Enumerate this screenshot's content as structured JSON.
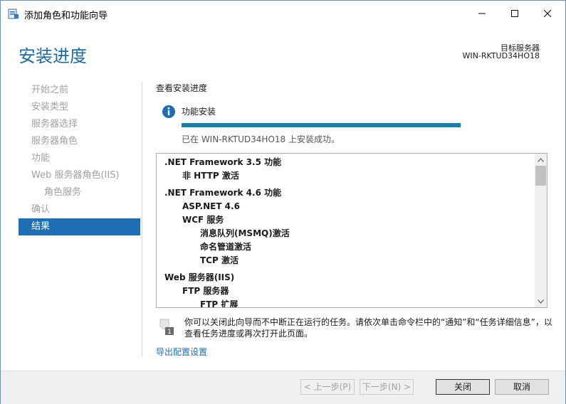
{
  "window": {
    "title": "添加角色和功能向导"
  },
  "header": {
    "page_title": "安装进度",
    "target_label": "目标服务器",
    "target_server": "WIN-RKTUD34HO18"
  },
  "nav": {
    "items": [
      {
        "label": "开始之前"
      },
      {
        "label": "安装类型"
      },
      {
        "label": "服务器选择"
      },
      {
        "label": "服务器角色"
      },
      {
        "label": "功能"
      },
      {
        "label": "Web 服务器角色(IIS)"
      },
      {
        "label": "角色服务"
      },
      {
        "label": "确认"
      },
      {
        "label": "结果"
      }
    ],
    "active_index": 8
  },
  "main": {
    "section_heading": "查看安装进度",
    "feature_label": "功能安装",
    "progress_fraction": 1.0,
    "success_message": "已在 WIN-RKTUD34HO18 上安装成功。",
    "results": [
      {
        "label": ".NET Framework 3.5 功能",
        "level": 0
      },
      {
        "label": "非 HTTP 激活",
        "level": 1
      },
      {
        "label": ".NET Framework 4.6 功能",
        "level": 0
      },
      {
        "label": "ASP.NET 4.6",
        "level": 1
      },
      {
        "label": "WCF 服务",
        "level": 1
      },
      {
        "label": "消息队列(MSMQ)激活",
        "level": 2
      },
      {
        "label": "命名管道激活",
        "level": 2
      },
      {
        "label": "TCP 激活",
        "level": 2
      },
      {
        "label": "Web 服务器(IIS)",
        "level": 0
      },
      {
        "label": "FTP 服务器",
        "level": 1
      },
      {
        "label": "FTP 扩展",
        "level": 2
      }
    ],
    "note": "你可以关闭此向导而不中断正在运行的任务。请依次单击命令栏中的“通知”和“任务详细信息”，以查看任务进度或再次打开此页面。",
    "export_link": "导出配置设置"
  },
  "footer": {
    "prev_label": "< 上一步(P)",
    "next_label": "下一步(N) >",
    "close_label": "关闭",
    "cancel_label": "取消"
  },
  "colors": {
    "accent": "#1f6db3",
    "progress": "#1b7ea6",
    "title_text": "#1e6aa8"
  },
  "icons": [
    "wizard-app-icon",
    "minimize-icon",
    "maximize-icon",
    "close-icon",
    "info-icon",
    "scroll-up-icon",
    "scroll-down-icon",
    "notification-flag-icon"
  ]
}
